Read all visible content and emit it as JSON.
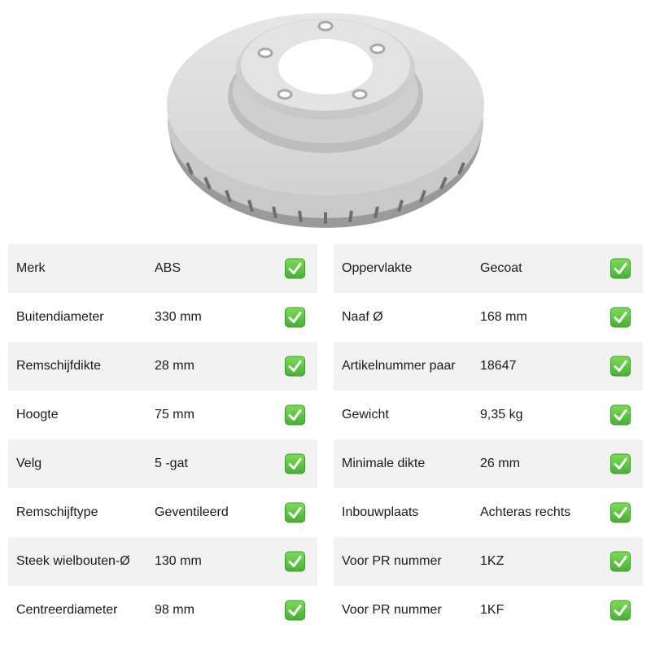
{
  "left_table": [
    {
      "label": "Merk",
      "value": "ABS"
    },
    {
      "label": "Buitendiameter",
      "value": "330 mm"
    },
    {
      "label": "Remschijfdikte",
      "value": "28 mm"
    },
    {
      "label": "Hoogte",
      "value": "75 mm"
    },
    {
      "label": "Velg",
      "value": "5 -gat"
    },
    {
      "label": "Remschijftype",
      "value": "Geventileerd"
    },
    {
      "label": "Steek wielbouten-Ø",
      "value": "130 mm"
    },
    {
      "label": "Centreerdiameter",
      "value": "98 mm"
    }
  ],
  "right_table": [
    {
      "label": "Oppervlakte",
      "value": "Gecoat"
    },
    {
      "label": "Naaf Ø",
      "value": "168 mm"
    },
    {
      "label": "Artikelnummer paar",
      "value": "18647"
    },
    {
      "label": "Gewicht",
      "value": "9,35 kg"
    },
    {
      "label": "Minimale dikte",
      "value": "26 mm"
    },
    {
      "label": "Inbouwplaats",
      "value": "Achteras rechts"
    },
    {
      "label": "Voor PR nummer",
      "value": "1KZ"
    },
    {
      "label": "Voor PR nummer",
      "value": "1KF"
    }
  ],
  "icons": {
    "row_status": "check-mark-icon",
    "product": "brake-disc-image"
  },
  "colors": {
    "row_shade": "#f2f2f2",
    "check_green": "#5cc240"
  }
}
